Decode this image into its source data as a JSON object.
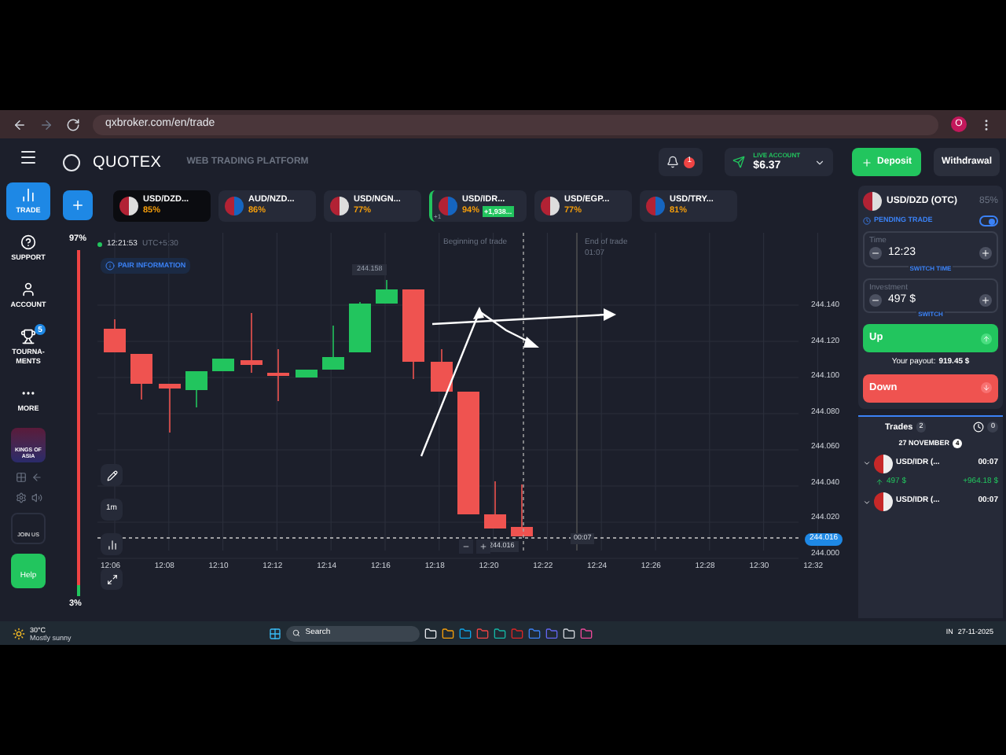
{
  "browser": {
    "url": "qxbroker.com/en/trade",
    "profile_initial": "O"
  },
  "header": {
    "logo": "QUOTEX",
    "subtitle": "WEB TRADING PLATFORM",
    "notifications": "1",
    "account_label": "LIVE ACCOUNT",
    "balance": "$6.37",
    "deposit": "Deposit",
    "withdrawal": "Withdrawal"
  },
  "sidebar": {
    "items": [
      {
        "label": "TRADE",
        "selected": true,
        "kind": "trade"
      },
      {
        "label": "SUPPORT",
        "selected": false,
        "kind": "support"
      },
      {
        "label": "ACCOUNT",
        "selected": false,
        "kind": "account"
      },
      {
        "label": "TOURNA-\nMENTS",
        "selected": false,
        "kind": "trophy",
        "badge": "5"
      },
      {
        "label": "MORE",
        "selected": false,
        "kind": "more"
      }
    ],
    "promo": "KINGS OF ASIA",
    "join": "JOIN US",
    "help": "Help"
  },
  "assets": [
    {
      "name": "USD/DZD...",
      "payout": "85%",
      "selected": true
    },
    {
      "name": "AUD/NZD...",
      "payout": "86%",
      "selected": false
    },
    {
      "name": "USD/NGN...",
      "payout": "77%",
      "selected": false
    },
    {
      "name": "USD/IDR...",
      "payout": "94%",
      "profit": "+1,938...",
      "count": "+1",
      "selected": false
    },
    {
      "name": "USD/EGP...",
      "payout": "77%",
      "selected": false
    },
    {
      "name": "USD/TRY...",
      "payout": "81%",
      "selected": false
    }
  ],
  "chart": {
    "clock": "12:21:53",
    "timezone": "UTC+5:30",
    "pair_info": "PAIR INFORMATION",
    "sentiment": {
      "up": "97%",
      "down": "3%",
      "level": 0.97
    },
    "high_label": "244.158",
    "low_label": "244.016",
    "timer": "00:07",
    "begin": "Beginning of trade",
    "end": "End of trade",
    "end_time": "01:07",
    "price": "244.016",
    "timeframe": "1m",
    "xticks": [
      "12:06",
      "12:08",
      "12:10",
      "12:12",
      "12:14",
      "12:16",
      "12:18",
      "12:20",
      "12:22",
      "12:24",
      "12:26",
      "12:28",
      "12:30",
      "12:32"
    ],
    "yticks": [
      "244.140",
      "244.120",
      "244.100",
      "244.080",
      "244.060",
      "244.040",
      "244.020",
      "244.000"
    ]
  },
  "trade_panel": {
    "pair": "USD/DZD (OTC)",
    "payout": "85%",
    "pending_label": "PENDING TRADE",
    "pending_on": true,
    "time_label": "Time",
    "time": "12:23",
    "switch_time": "SWITCH TIME",
    "investment_label": "Investment",
    "investment": "497 $",
    "switch": "SWITCH",
    "up": "Up",
    "payout_label": "Your payout:",
    "payout_value": "919.45 $",
    "down": "Down"
  },
  "trades": {
    "label": "Trades",
    "count": "2",
    "closed_count": "0",
    "date": "27 NOVEMBER",
    "date_count": "4",
    "items": [
      {
        "pair": "USD/IDR (...",
        "time": "00:07",
        "amount": "497 $",
        "profit": "+964.18 $"
      },
      {
        "pair": "USD/IDR (...",
        "time": "00:07"
      }
    ]
  },
  "taskbar": {
    "temperature": "30°C",
    "weather": "Mostly sunny",
    "search": "Search",
    "lang": "IN",
    "date": "27-11-2025"
  }
}
